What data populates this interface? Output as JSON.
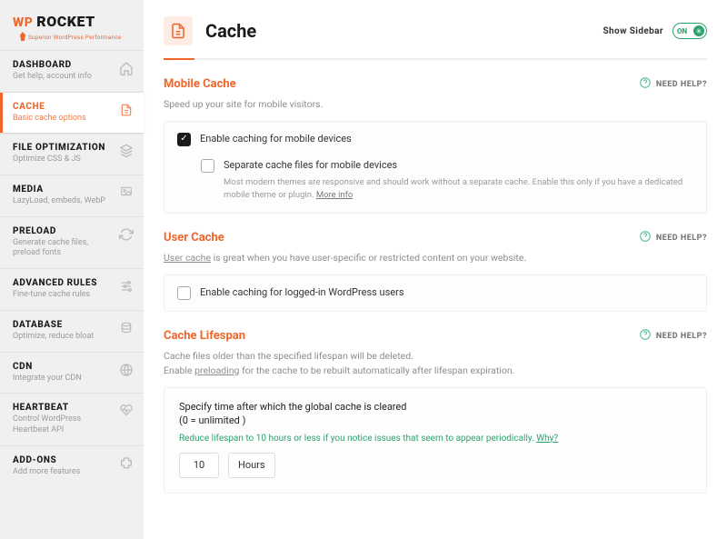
{
  "brand": {
    "wp": "WP",
    "name": "ROCKET",
    "tagline": "Superior WordPress Performance"
  },
  "sidebar": {
    "items": [
      {
        "title": "DASHBOARD",
        "sub": "Get help, account info",
        "icon": "home"
      },
      {
        "title": "CACHE",
        "sub": "Basic cache options",
        "icon": "doc",
        "active": true
      },
      {
        "title": "FILE OPTIMIZATION",
        "sub": "Optimize CSS & JS",
        "icon": "layers"
      },
      {
        "title": "MEDIA",
        "sub": "LazyLoad, embeds, WebP",
        "icon": "image"
      },
      {
        "title": "PRELOAD",
        "sub": "Generate cache files, preload fonts",
        "icon": "refresh"
      },
      {
        "title": "ADVANCED RULES",
        "sub": "Fine-tune cache rules",
        "icon": "sliders"
      },
      {
        "title": "DATABASE",
        "sub": "Optimize, reduce bloat",
        "icon": "database"
      },
      {
        "title": "CDN",
        "sub": "Integrate your CDN",
        "icon": "globe"
      },
      {
        "title": "HEARTBEAT",
        "sub": "Control WordPress Heartbeat API",
        "icon": "heartbeat"
      },
      {
        "title": "ADD-ONS",
        "sub": "Add more features",
        "icon": "puzzle"
      }
    ]
  },
  "page": {
    "title": "Cache",
    "show_sidebar_label": "Show Sidebar",
    "toggle_label": "ON",
    "need_help_label": "NEED HELP?"
  },
  "mobile": {
    "title": "Mobile Cache",
    "desc": "Speed up your site for mobile visitors.",
    "opt1": {
      "label": "Enable caching for mobile devices",
      "checked": true
    },
    "opt2": {
      "label": "Separate cache files for mobile devices",
      "checked": false,
      "desc": "Most modern themes are responsive and should work without a separate cache. Enable this only if you have a dedicated mobile theme or plugin. ",
      "more": "More info"
    }
  },
  "user": {
    "title": "User Cache",
    "desc_link": "User cache",
    "desc_rest": " is great when you have user-specific or restricted content on your website.",
    "opt": {
      "label": "Enable caching for logged-in WordPress users",
      "checked": false
    }
  },
  "lifespan": {
    "title": "Cache Lifespan",
    "desc1": "Cache files older than the specified lifespan will be deleted.",
    "desc2_a": "Enable ",
    "desc2_link": "preloading",
    "desc2_b": " for the cache to be rebuilt automatically after lifespan expiration.",
    "panel_title": "Specify time after which the global cache is cleared",
    "panel_zero": "(0 = unlimited )",
    "tip": "Reduce lifespan to 10 hours or less if you notice issues that seem to appear periodically. ",
    "why": "Why?",
    "value": "10",
    "unit": "Hours"
  }
}
